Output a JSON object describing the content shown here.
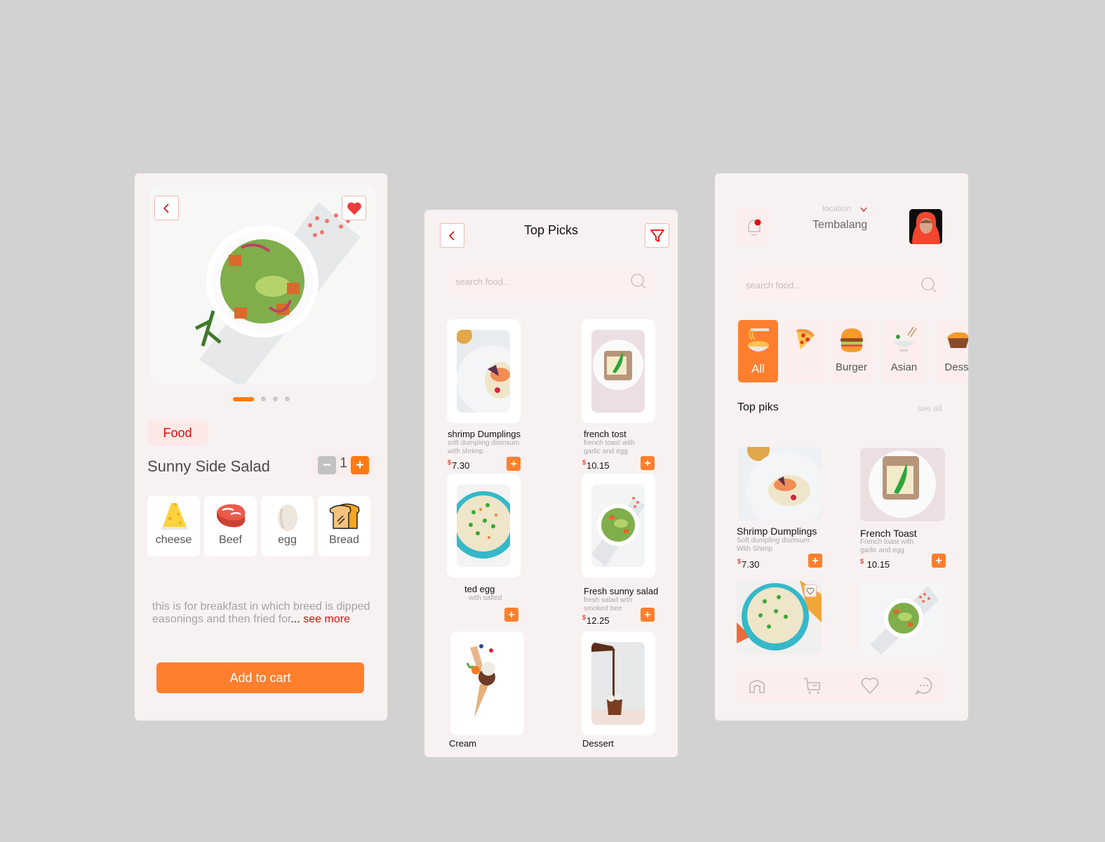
{
  "colors": {
    "accent": "#ff7f2e",
    "red": "#e60a0a",
    "screen_bg": "#f7f2f1",
    "page_bg": "#d2d2d2"
  },
  "detail_screen": {
    "back_icon": "chevron-left-icon",
    "favorite_icon": "heart-filled-icon",
    "carousel": {
      "total": 4,
      "active_index": 0
    },
    "tag": "Food",
    "title": "Sunny Side Salad",
    "quantity": {
      "minus": "−",
      "value": "1",
      "plus": "+"
    },
    "ingredients": [
      {
        "label": "cheese",
        "icon": "cheese-icon"
      },
      {
        "label": "Beef",
        "icon": "beef-icon"
      },
      {
        "label": "egg",
        "icon": "egg-icon"
      },
      {
        "label": "Bread",
        "icon": "bread-icon"
      }
    ],
    "description": "this is for  breakfast in which breed is dipped easonings and then fried for",
    "ellipsis": "...",
    "see_more": " see more",
    "add_to_cart": "Add to cart"
  },
  "top_picks_screen": {
    "back_icon": "chevron-left-icon",
    "title": "Top Picks",
    "filter_icon": "filter-icon",
    "search": {
      "placeholder": "search food...",
      "value": ""
    },
    "items": [
      {
        "name": "shrimp Dumplings",
        "desc": "soft dumpling dismsum with shrimp",
        "currency": "$",
        "price": "7.30",
        "add": "+"
      },
      {
        "name": "french tost",
        "desc": "french toast with garlic and egg",
        "currency": "$",
        "price": "10.15",
        "add": "+"
      },
      {
        "name": "ted egg",
        "desc": "with salted",
        "currency": "",
        "price": "",
        "add": "+"
      },
      {
        "name": "Fresh sunny salad",
        "desc": "fresh salad with smoked bee",
        "currency": "$",
        "price": "12.25",
        "add": "+"
      },
      {
        "name": "Cream",
        "desc": "",
        "currency": "",
        "price": "",
        "add": ""
      },
      {
        "name": "Dessert",
        "desc": "",
        "currency": "",
        "price": "",
        "add": ""
      }
    ]
  },
  "home_screen": {
    "notification_icon": "bell-icon",
    "location_label": "location",
    "location_value": "Tembalang",
    "search": {
      "placeholder": "search food...",
      "value": ""
    },
    "categories": [
      {
        "label": "All",
        "icon": "noodles-icon",
        "active": true
      },
      {
        "label": "",
        "icon": "pizza-icon",
        "active": false
      },
      {
        "label": "Burger",
        "icon": "burger-icon",
        "active": false
      },
      {
        "label": "Asian",
        "icon": "rice-bowl-icon",
        "active": false
      },
      {
        "label": "Dess",
        "icon": "dessert-icon",
        "active": false
      }
    ],
    "section_title": "Top piks",
    "see_all": "see all",
    "items": [
      {
        "name": "Shrimp  Dumplings",
        "desc": "Soft dumpling dismsum With Shimp",
        "currency": "$",
        "price": "7.30",
        "add": "+"
      },
      {
        "name": "French  Toast",
        "desc": "French toast with garlic and egg",
        "currency": "$",
        "price": " 10.15",
        "add": "+"
      }
    ],
    "nav": [
      "home-icon",
      "cart-icon",
      "heart-icon",
      "chat-icon"
    ]
  }
}
